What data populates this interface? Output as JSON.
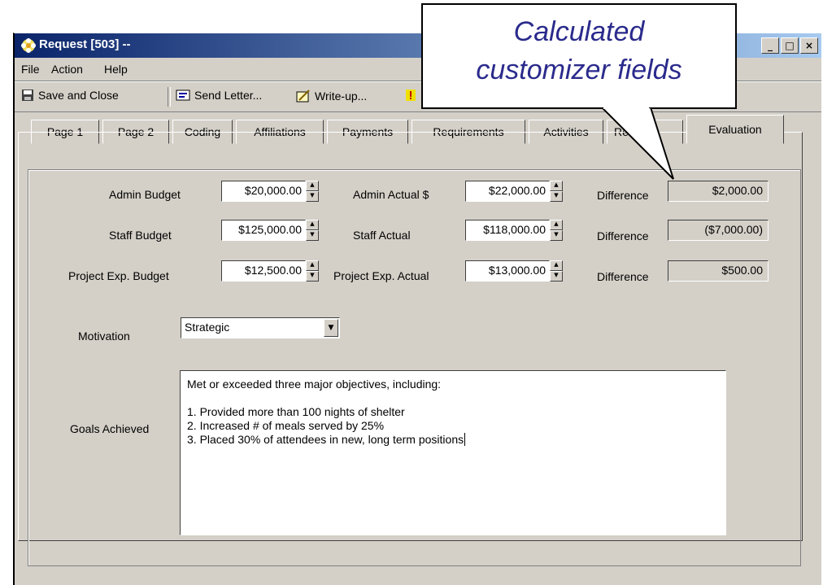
{
  "window": {
    "title": "Request [503] --",
    "controls": [
      "_",
      "□",
      "×"
    ]
  },
  "menu": {
    "file": "File",
    "action": "Action",
    "help": "Help"
  },
  "toolbar": {
    "save_close": "Save and Close",
    "send_letter": "Send Letter...",
    "write_up": "Write-up..."
  },
  "tabs": [
    {
      "label": "Page 1"
    },
    {
      "label": "Page 2"
    },
    {
      "label": "Coding"
    },
    {
      "label": "Affiliations"
    },
    {
      "label": "Payments"
    },
    {
      "label": "Requirements"
    },
    {
      "label": "Activities"
    },
    {
      "label": "Re"
    },
    {
      "label": "Evaluation"
    }
  ],
  "budget": {
    "rows": [
      {
        "budget_label": "Admin Budget",
        "budget_value": "$20,000.00",
        "actual_label": "Admin Actual $",
        "actual_value": "$22,000.00",
        "diff_label": "Difference",
        "diff_value": "$2,000.00"
      },
      {
        "budget_label": "Staff Budget",
        "budget_value": "$125,000.00",
        "actual_label": "Staff Actual",
        "actual_value": "$118,000.00",
        "diff_label": "Difference",
        "diff_value": "($7,000.00)"
      },
      {
        "budget_label": "Project Exp. Budget",
        "budget_value": "$12,500.00",
        "actual_label": "Project Exp. Actual",
        "actual_value": "$13,000.00",
        "diff_label": "Difference",
        "diff_value": "$500.00"
      }
    ]
  },
  "motivation": {
    "label": "Motivation",
    "value": "Strategic"
  },
  "goals": {
    "label": "Goals Achieved",
    "lines": [
      "Met or exceeded three major objectives, including:",
      "",
      "1.  Provided more than 100 nights of shelter",
      "2.  Increased # of meals served by 25%",
      "3.  Placed 30% of attendees in new, long term positions"
    ]
  },
  "callout": {
    "line1": "Calculated",
    "line2": "customizer fields"
  }
}
